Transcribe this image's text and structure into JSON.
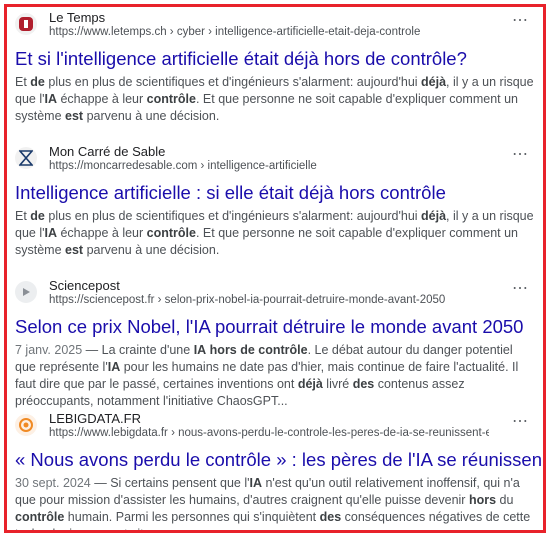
{
  "results": [
    {
      "site": "Le Temps",
      "url": "https://www.letemps.ch › cyber › intelligence-artificielle-etait-deja-controle",
      "title": "Et si l'intelligence artificielle était déjà hors de contrôle?",
      "date": "",
      "snippet_parts": [
        "Et ",
        "de",
        " plus en plus de scientifiques et d'ingénieurs s'alarment: aujourd'hui ",
        "déjà",
        ", il y a un risque que l'",
        "IA",
        " échappe à leur ",
        "contrôle",
        ". Et que personne ne soit capable d'expliquer comment un système ",
        "est",
        " parvenu à une décision."
      ],
      "favicon": "letemps-icon",
      "favicon_color": "#b01e2d"
    },
    {
      "site": "Mon Carré de Sable",
      "url": "https://moncarredesable.com › intelligence-artificielle",
      "title": "Intelligence artificielle : si elle était déjà hors contrôle",
      "date": "",
      "snippet_parts": [
        "Et ",
        "de",
        " plus en plus de scientifiques et d'ingénieurs s'alarment: aujourd'hui ",
        "déjà",
        ", il y a un risque que l'",
        "IA",
        " échappe à leur ",
        "contrôle",
        ". Et que personne ne soit capable d'expliquer comment un système ",
        "est",
        " parvenu à une décision."
      ],
      "favicon": "hourglass-icon",
      "favicon_color": "#1a3a6b"
    },
    {
      "site": "Sciencepost",
      "url": "https://sciencepost.fr › selon-prix-nobel-ia-pourrait-detruire-monde-avant-2050",
      "title": "Selon ce prix Nobel, l'IA pourrait détruire le monde avant 2050",
      "date": "7 janv. 2025",
      "snippet_parts": [
        "La crainte d'une ",
        "IA",
        " ",
        "hors de contrôle",
        ". Le débat autour du danger potentiel que représente l'",
        "IA",
        " pour les humains ne date pas d'hier, mais continue de faire l'actualité. Il faut dire que par le passé, certaines inventions ont ",
        "déjà",
        " livré ",
        "des",
        " contenus assez préoccupants, notamment l'initiative ChaosGPT..."
      ],
      "favicon": "play-icon",
      "favicon_color": "#8a8f96"
    },
    {
      "site": "LEBIGDATA.FR",
      "url": "https://www.lebigdata.fr › nous-avons-perdu-le-controle-les-peres-de-ia-se-reunissent-en-urgen...",
      "title": "« Nous avons perdu le contrôle » : les pères de l'IA se réunissen...",
      "date": "30 sept. 2024",
      "snippet_parts": [
        "Si certains pensent que l'",
        "IA",
        " n'est qu'un outil relativement inoffensif, qui n'a que pour mission d'assister les humains, d'autres craignent qu'elle puisse devenir ",
        "hors",
        " du ",
        "contrôle",
        " humain. Parmi les personnes qui s'inquiètent ",
        "des",
        " conséquences négatives de cette technologie, on peut citer..."
      ],
      "favicon": "lebigdata-icon",
      "favicon_color": "#f08a24"
    }
  ],
  "more_label": "⋮"
}
